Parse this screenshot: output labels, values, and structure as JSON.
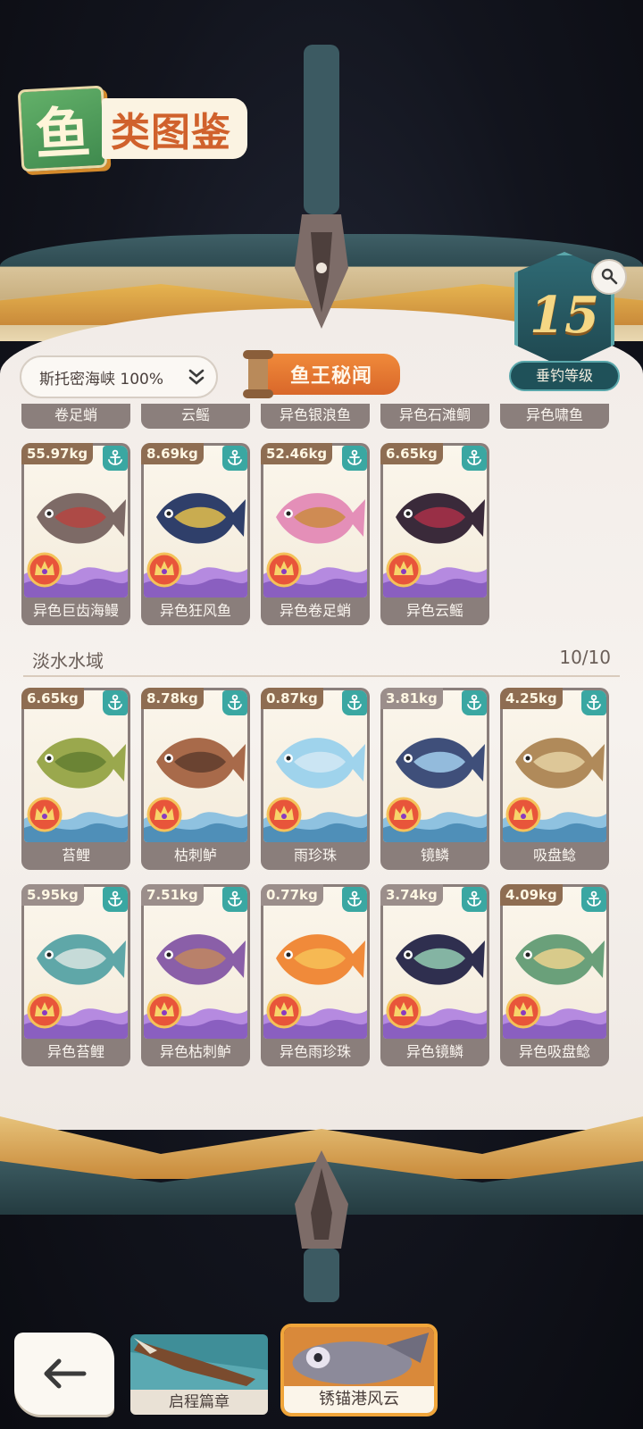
{
  "title": {
    "badge_char": "鱼",
    "rest": "类图鉴"
  },
  "level": {
    "number": "15",
    "label": "垂钓等级"
  },
  "area_select": {
    "label": "斯托密海峡 100%"
  },
  "legend_button": {
    "label": "鱼王秘闻"
  },
  "top_row_names": [
    "卷足蛸",
    "云鳐",
    "异色银浪鱼",
    "异色石滩鲷",
    "异色啸鱼"
  ],
  "row_marine_shiny": [
    {
      "weight": "55.97kg",
      "name": "异色巨齿海鳗"
    },
    {
      "weight": "8.69kg",
      "name": "异色狂风鱼"
    },
    {
      "weight": "52.46kg",
      "name": "异色卷足蛸"
    },
    {
      "weight": "6.65kg",
      "name": "异色云鳐"
    }
  ],
  "freshwater": {
    "label": "淡水水域",
    "count": "10/10",
    "row1": [
      {
        "weight": "6.65kg",
        "name": "苔鲤"
      },
      {
        "weight": "8.78kg",
        "name": "枯刺鲈"
      },
      {
        "weight": "0.87kg",
        "name": "雨珍珠"
      },
      {
        "weight": "3.81kg",
        "name": "镜鳞"
      },
      {
        "weight": "4.25kg",
        "name": "吸盘鲶"
      }
    ],
    "row2": [
      {
        "weight": "5.95kg",
        "name": "异色苔鲤"
      },
      {
        "weight": "7.51kg",
        "name": "异色枯刺鲈"
      },
      {
        "weight": "0.77kg",
        "name": "异色雨珍珠"
      },
      {
        "weight": "3.74kg",
        "name": "异色镜鳞"
      },
      {
        "weight": "4.09kg",
        "name": "异色吸盘鲶"
      }
    ]
  },
  "chapters": [
    {
      "label": "启程篇章"
    },
    {
      "label": "锈锚港风云"
    }
  ],
  "colors": {
    "accent": "#d9672a",
    "anchor": "#3aa7a2",
    "card": "#8a7e7b"
  }
}
